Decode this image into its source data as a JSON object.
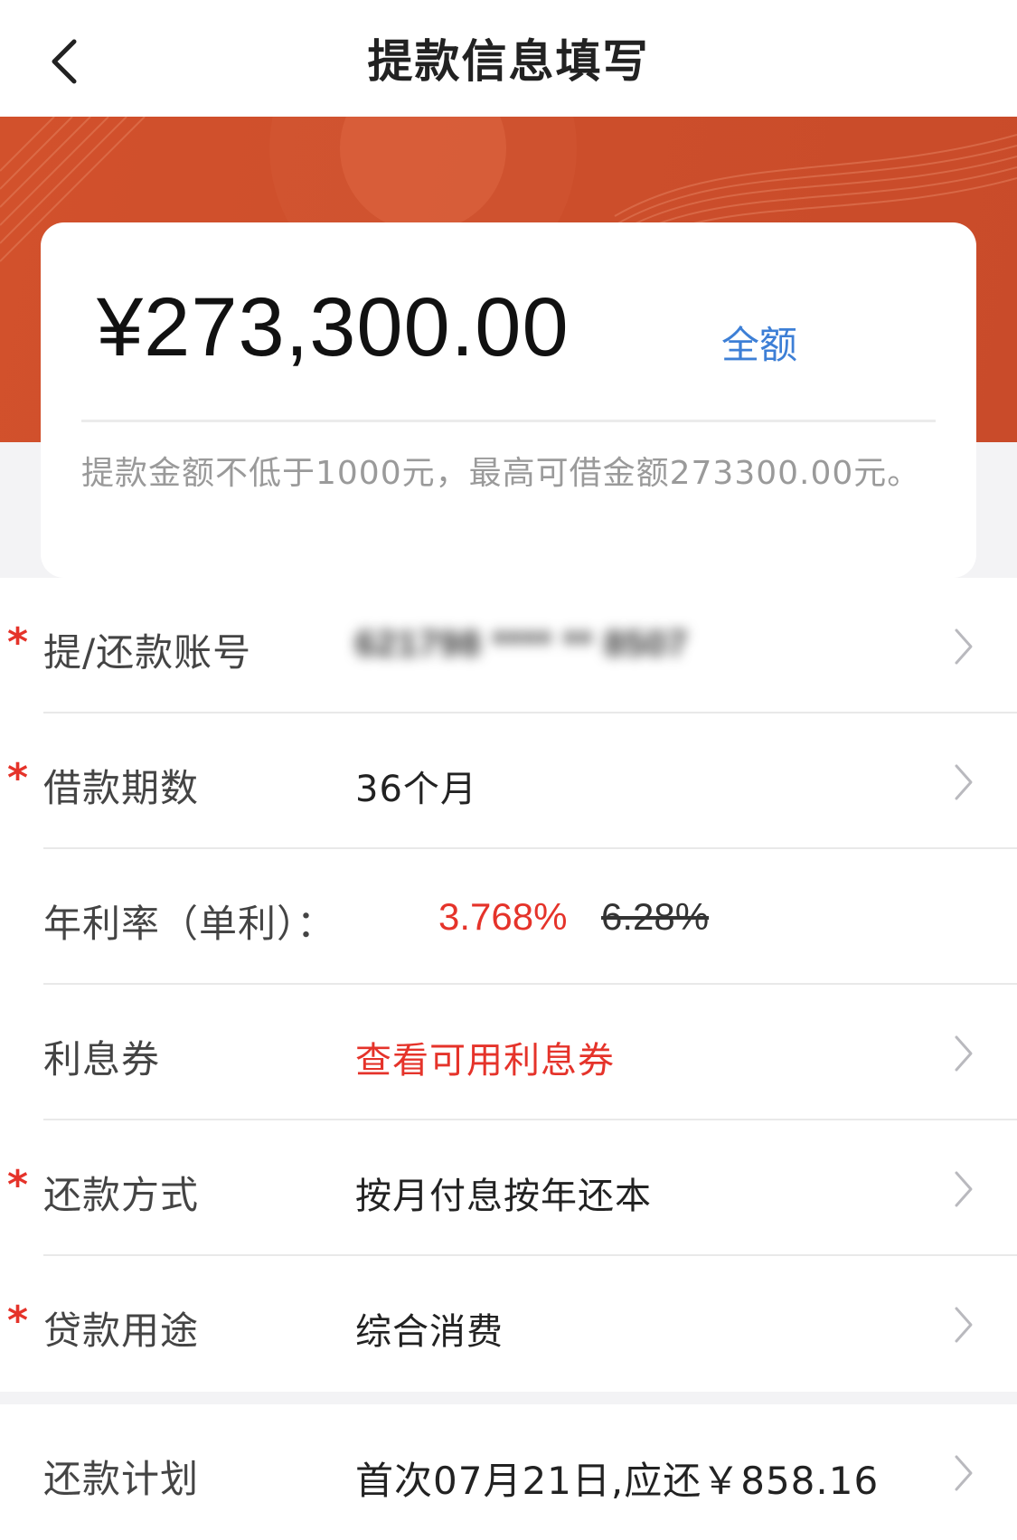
{
  "nav": {
    "title": "提款信息填写"
  },
  "card": {
    "amount": "¥273,300.00",
    "full_label": "全额",
    "hint": "提款金额不低于1000元，最高可借金额273300.00元。"
  },
  "rows": {
    "account": {
      "label": "提/还款账号",
      "value": "621798 **** ** 8507"
    },
    "term": {
      "label": "借款期数",
      "value": "36个月"
    },
    "rate": {
      "label": "年利率（单利）：",
      "new": "3.768%",
      "old": "6.28%"
    },
    "coupon": {
      "label": "利息券",
      "value": "查看可用利息券"
    },
    "method": {
      "label": "还款方式",
      "value": "按月付息按年还本"
    },
    "purpose": {
      "label": "贷款用途",
      "value": "综合消费"
    },
    "plan": {
      "label": "还款计划",
      "value": "首次07月21日,应还￥858.16"
    }
  },
  "required_mark": "*",
  "colors": {
    "accent": "#cc4e2b",
    "link": "#3d7fd6",
    "highlight": "#e5332a"
  },
  "icons": {
    "back": "chevron-left-icon",
    "row_arrow": "chevron-right-icon"
  }
}
